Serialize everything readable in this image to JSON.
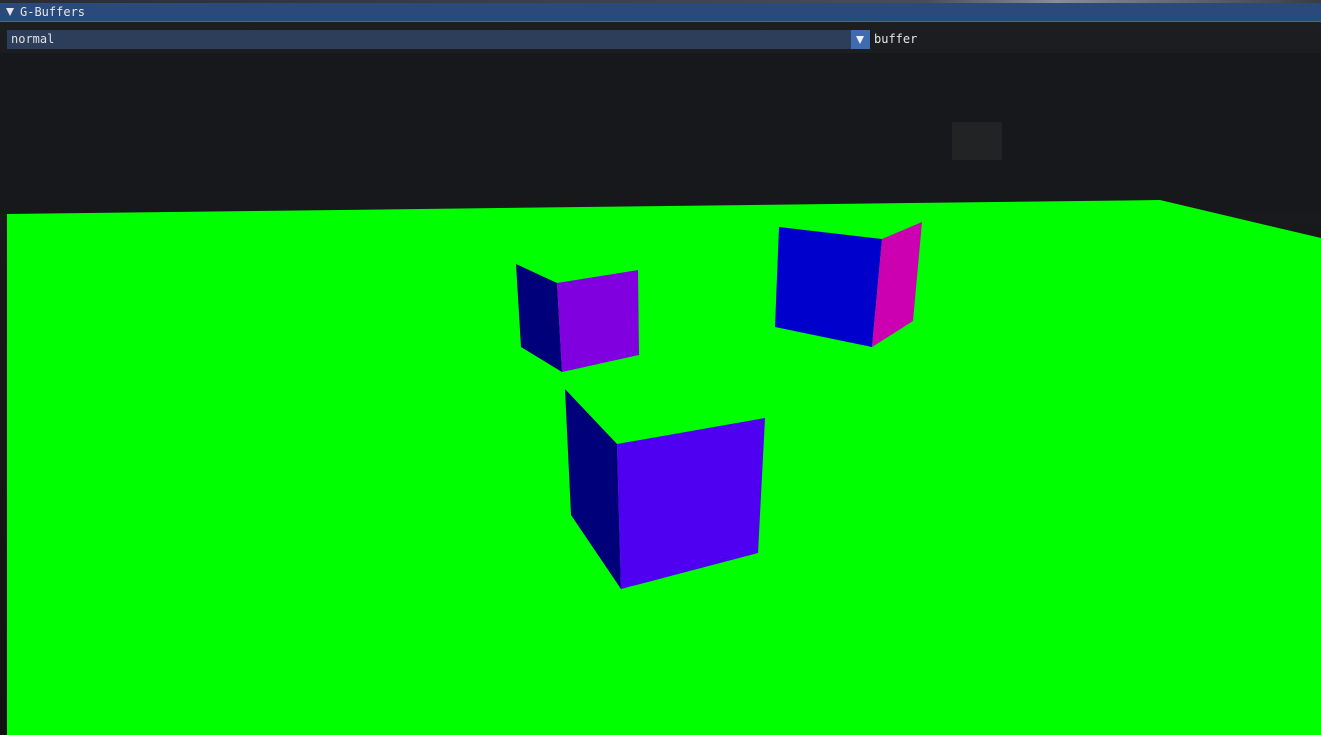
{
  "window": {
    "title": "G-Buffers"
  },
  "buffer_select": {
    "selected": "normal",
    "label": "buffer"
  },
  "colors": {
    "title_bar": "#294a7a",
    "combo_bg": "#2c3e5a",
    "combo_button": "#3f6cb0",
    "floor_normal": "#00ff00",
    "cube_front_left": "#8000e0",
    "cube_front_center": "#5000f0",
    "cube_front_right": "#0000cc",
    "cube_side_dark": "#00007a",
    "cube_side_magenta": "#cc00b0"
  },
  "icons": {
    "collapse": "triangle-down-icon",
    "dropdown": "triangle-down-icon"
  }
}
